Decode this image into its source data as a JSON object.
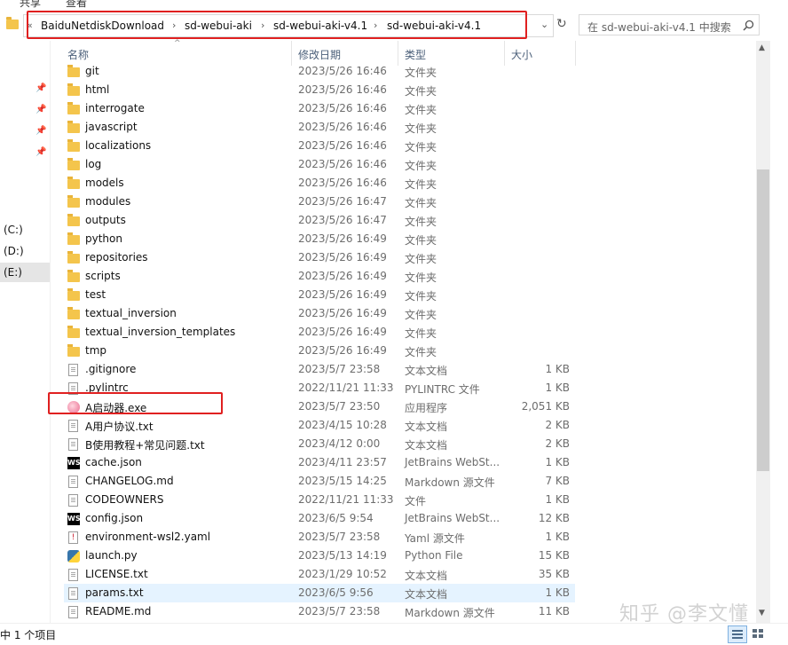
{
  "ribbon": {
    "tabs": [
      "共享",
      "查看"
    ]
  },
  "address": {
    "overflow": "«",
    "crumbs": [
      "BaiduNetdiskDownload",
      "sd-webui-aki",
      "sd-webui-aki-v4.1",
      "sd-webui-aki-v4.1"
    ],
    "dropdown_icon": "chevron-down-icon",
    "refresh_icon": "refresh-icon"
  },
  "search": {
    "placeholder": "在 sd-webui-aki-v4.1 中搜索",
    "icon": "search-icon"
  },
  "nav": {
    "drives": [
      "(C:)",
      "(D:)",
      "(E:)"
    ],
    "selected_drive": 2
  },
  "columns": {
    "name": "名称",
    "date": "修改日期",
    "type": "类型",
    "size": "大小"
  },
  "files": [
    {
      "name": "git",
      "date": "2023/5/26 16:46",
      "type": "文件夹",
      "size": "",
      "icon": "folder"
    },
    {
      "name": "html",
      "date": "2023/5/26 16:46",
      "type": "文件夹",
      "size": "",
      "icon": "folder"
    },
    {
      "name": "interrogate",
      "date": "2023/5/26 16:46",
      "type": "文件夹",
      "size": "",
      "icon": "folder"
    },
    {
      "name": "javascript",
      "date": "2023/5/26 16:46",
      "type": "文件夹",
      "size": "",
      "icon": "folder"
    },
    {
      "name": "localizations",
      "date": "2023/5/26 16:46",
      "type": "文件夹",
      "size": "",
      "icon": "folder"
    },
    {
      "name": "log",
      "date": "2023/5/26 16:46",
      "type": "文件夹",
      "size": "",
      "icon": "folder"
    },
    {
      "name": "models",
      "date": "2023/5/26 16:46",
      "type": "文件夹",
      "size": "",
      "icon": "folder"
    },
    {
      "name": "modules",
      "date": "2023/5/26 16:47",
      "type": "文件夹",
      "size": "",
      "icon": "folder"
    },
    {
      "name": "outputs",
      "date": "2023/5/26 16:47",
      "type": "文件夹",
      "size": "",
      "icon": "folder"
    },
    {
      "name": "python",
      "date": "2023/5/26 16:49",
      "type": "文件夹",
      "size": "",
      "icon": "folder"
    },
    {
      "name": "repositories",
      "date": "2023/5/26 16:49",
      "type": "文件夹",
      "size": "",
      "icon": "folder"
    },
    {
      "name": "scripts",
      "date": "2023/5/26 16:49",
      "type": "文件夹",
      "size": "",
      "icon": "folder"
    },
    {
      "name": "test",
      "date": "2023/5/26 16:49",
      "type": "文件夹",
      "size": "",
      "icon": "folder"
    },
    {
      "name": "textual_inversion",
      "date": "2023/5/26 16:49",
      "type": "文件夹",
      "size": "",
      "icon": "folder"
    },
    {
      "name": "textual_inversion_templates",
      "date": "2023/5/26 16:49",
      "type": "文件夹",
      "size": "",
      "icon": "folder"
    },
    {
      "name": "tmp",
      "date": "2023/5/26 16:49",
      "type": "文件夹",
      "size": "",
      "icon": "folder"
    },
    {
      "name": ".gitignore",
      "date": "2023/5/7 23:58",
      "type": "文本文档",
      "size": "1 KB",
      "icon": "doc"
    },
    {
      "name": ".pylintrc",
      "date": "2022/11/21 11:33",
      "type": "PYLINTRC 文件",
      "size": "1 KB",
      "icon": "doc"
    },
    {
      "name": "A启动器.exe",
      "date": "2023/5/7 23:50",
      "type": "应用程序",
      "size": "2,051 KB",
      "icon": "exe"
    },
    {
      "name": "A用户协议.txt",
      "date": "2023/4/15 10:28",
      "type": "文本文档",
      "size": "2 KB",
      "icon": "doc"
    },
    {
      "name": "B使用教程+常见问题.txt",
      "date": "2023/4/12 0:00",
      "type": "文本文档",
      "size": "2 KB",
      "icon": "doc"
    },
    {
      "name": "cache.json",
      "date": "2023/4/11 23:57",
      "type": "JetBrains WebSt...",
      "size": "1 KB",
      "icon": "ws"
    },
    {
      "name": "CHANGELOG.md",
      "date": "2023/5/15 14:25",
      "type": "Markdown 源文件",
      "size": "7 KB",
      "icon": "doc"
    },
    {
      "name": "CODEOWNERS",
      "date": "2022/11/21 11:33",
      "type": "文件",
      "size": "1 KB",
      "icon": "doc"
    },
    {
      "name": "config.json",
      "date": "2023/6/5 9:54",
      "type": "JetBrains WebSt...",
      "size": "12 KB",
      "icon": "ws"
    },
    {
      "name": "environment-wsl2.yaml",
      "date": "2023/5/7 23:58",
      "type": "Yaml 源文件",
      "size": "1 KB",
      "icon": "yaml"
    },
    {
      "name": "launch.py",
      "date": "2023/5/13 14:19",
      "type": "Python File",
      "size": "15 KB",
      "icon": "py"
    },
    {
      "name": "LICENSE.txt",
      "date": "2023/1/29 10:52",
      "type": "文本文档",
      "size": "35 KB",
      "icon": "doc"
    },
    {
      "name": "params.txt",
      "date": "2023/6/5 9:56",
      "type": "文本文档",
      "size": "1 KB",
      "icon": "doc"
    },
    {
      "name": "README.md",
      "date": "2023/5/7 23:58",
      "type": "Markdown 源文件",
      "size": "11 KB",
      "icon": "doc"
    }
  ],
  "selected_index": 28,
  "status": {
    "text": "中 1 个项目"
  },
  "watermark": "知乎 @李文懂",
  "colors": {
    "highlight": "#e02020",
    "selection": "#e5f3ff",
    "folder": "#f4c54c"
  }
}
